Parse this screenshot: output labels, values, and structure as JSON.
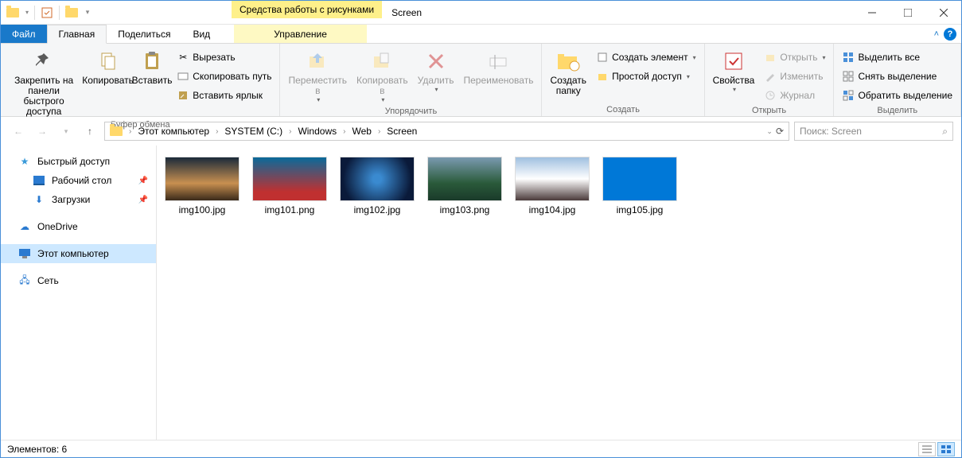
{
  "title": "Screen",
  "context_tab": "Средства работы с рисунками",
  "tabs": {
    "file": "Файл",
    "home": "Главная",
    "share": "Поделиться",
    "view": "Вид",
    "manage": "Управление"
  },
  "ribbon": {
    "group_clipboard": "Буфер обмена",
    "group_organize": "Упорядочить",
    "group_new": "Создать",
    "group_open": "Открыть",
    "group_select": "Выделить",
    "pin": "Закрепить на панели\nбыстрого доступа",
    "copy": "Копировать",
    "paste": "Вставить",
    "cut": "Вырезать",
    "copy_path": "Скопировать путь",
    "paste_shortcut": "Вставить ярлык",
    "move_to": "Переместить\nв",
    "copy_to": "Копировать\nв",
    "delete": "Удалить",
    "rename": "Переименовать",
    "new_folder": "Создать\nпапку",
    "new_item": "Создать элемент",
    "easy_access": "Простой доступ",
    "properties": "Свойства",
    "open": "Открыть",
    "edit": "Изменить",
    "history": "Журнал",
    "select_all": "Выделить все",
    "select_none": "Снять выделение",
    "invert_selection": "Обратить выделение"
  },
  "breadcrumb": [
    "Этот компьютер",
    "SYSTEM (C:)",
    "Windows",
    "Web",
    "Screen"
  ],
  "search_placeholder": "Поиск: Screen",
  "nav": {
    "quick_access": "Быстрый доступ",
    "desktop": "Рабочий стол",
    "downloads": "Загрузки",
    "onedrive": "OneDrive",
    "this_pc": "Этот компьютер",
    "network": "Сеть"
  },
  "files": [
    {
      "name": "img100.jpg",
      "bg": "linear-gradient(180deg,#1a2a3a 0%,#c89050 60%,#3a2a1a 100%)"
    },
    {
      "name": "img101.png",
      "bg": "linear-gradient(180deg,#0a6a9a 0%,#c03030 80%)"
    },
    {
      "name": "img102.jpg",
      "bg": "radial-gradient(circle,#3a8ad0 10%,#0a1a3a 80%)"
    },
    {
      "name": "img103.png",
      "bg": "linear-gradient(180deg,#7a9ab0 0%,#2a5a3a 60%,#1a3a2a 100%)"
    },
    {
      "name": "img104.jpg",
      "bg": "linear-gradient(180deg,#a0c0e0 0%,#ffffff 50%,#4a3a3a 100%)"
    },
    {
      "name": "img105.jpg",
      "bg": "#0078d7"
    }
  ],
  "status": {
    "count_label": "Элементов: 6"
  }
}
